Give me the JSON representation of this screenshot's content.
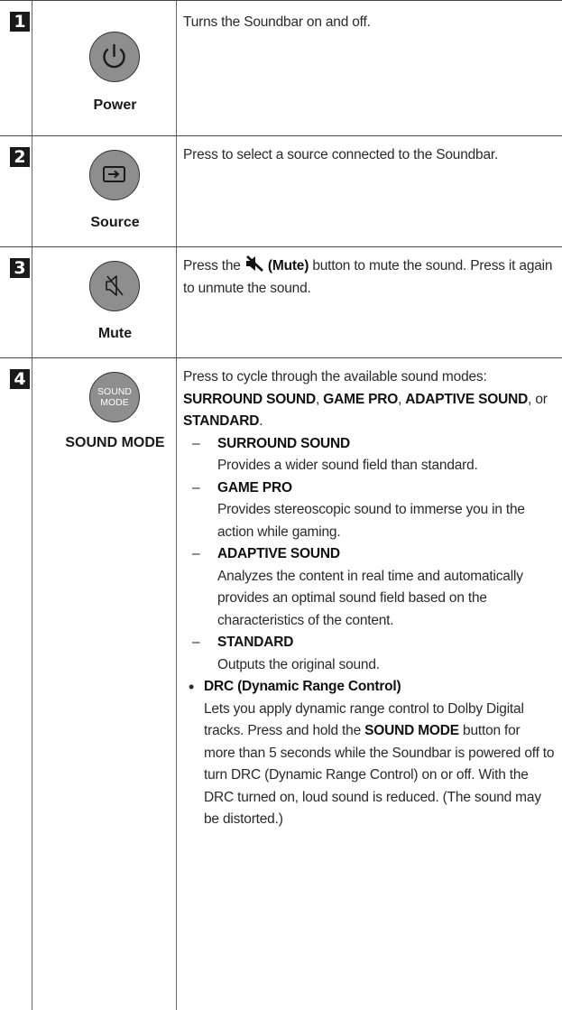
{
  "rows": [
    {
      "number": "1",
      "icon": "power-icon",
      "label": "Power",
      "desc": "Turns the Soundbar on and off."
    },
    {
      "number": "2",
      "icon": "source-icon",
      "label": "Source",
      "desc": "Press to select a source connected to the Soundbar."
    },
    {
      "number": "3",
      "icon": "mute-icon",
      "label": "Mute",
      "desc_pre": "Press the",
      "desc_bold": "(Mute)",
      "desc_post": "button to mute the sound. Press it again to unmute the sound."
    },
    {
      "number": "4",
      "icon": "sound-mode-icon",
      "icon_text_1": "SOUND",
      "icon_text_2": "MODE",
      "label": "SOUND MODE",
      "intro": "Press to cycle through the available sound modes:",
      "modes_list": [
        "SURROUND SOUND",
        "GAME PRO",
        "ADAPTIVE SOUND",
        "STANDARD"
      ],
      "sep1": ", ",
      "sep2": ", ",
      "sep3": ",",
      "or_text": "or ",
      "end_text": ".",
      "dash": "–",
      "modes": [
        {
          "name": "SURROUND SOUND",
          "desc": "Provides a wider sound field than standard."
        },
        {
          "name": "GAME PRO",
          "desc": "Provides stereoscopic sound to immerse you in the action while gaming."
        },
        {
          "name": "ADAPTIVE SOUND",
          "desc": "Analyzes the content in real time and automatically provides an optimal sound field based on the characteristics of the content."
        },
        {
          "name": "STANDARD",
          "desc": "Outputs the original sound."
        }
      ],
      "bullet": "•",
      "drc_title": "DRC (Dynamic Range Control)",
      "drc_pre": "Lets you apply dynamic range control to Dolby Digital tracks. Press and hold the",
      "drc_bold": "SOUND MODE",
      "drc_post": "button for more than 5 seconds while the Soundbar is powered off to turn DRC (Dynamic Range Control) on or off. With the DRC turned on, loud sound is reduced. (The sound may be distorted.)"
    }
  ],
  "colors": {
    "button_fill": "#8e8e8e",
    "number_bg": "#1a1a1a",
    "border": "#444444"
  }
}
